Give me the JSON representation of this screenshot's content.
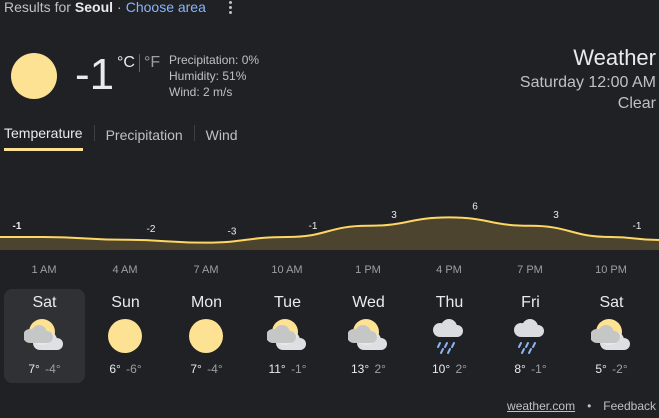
{
  "header": {
    "results_prefix": "Results for",
    "location": "Seoul",
    "separator": "·",
    "choose_area": "Choose area"
  },
  "current": {
    "temperature": "-1",
    "unit_c": "°C",
    "unit_f": "°F",
    "precipitation": "Precipitation: 0%",
    "humidity": "Humidity: 51%",
    "wind": "Wind: 2 m/s",
    "icon": "sun-icon"
  },
  "summary": {
    "title": "Weather",
    "time": "Saturday 12:00 AM",
    "condition": "Clear"
  },
  "tabs": [
    {
      "label": "Temperature",
      "active": true
    },
    {
      "label": "Precipitation",
      "active": false
    },
    {
      "label": "Wind",
      "active": false
    }
  ],
  "chart_data": {
    "type": "area",
    "x": [
      "1 AM",
      "4 AM",
      "7 AM",
      "10 AM",
      "1 PM",
      "4 PM",
      "7 PM",
      "10 PM"
    ],
    "values": [
      -1,
      -2,
      -3,
      -1,
      3,
      6,
      3,
      -1
    ],
    "labels": [
      "-1",
      "-2",
      "-3",
      "-1",
      "3",
      "6",
      "3",
      "-1"
    ],
    "line_color": "#fdd663",
    "fill_color": "#4d4430"
  },
  "days": [
    {
      "name": "Sat",
      "high": "7°",
      "low": "-4°",
      "icon": "partly-cloudy-icon",
      "selected": true
    },
    {
      "name": "Sun",
      "high": "6°",
      "low": "-6°",
      "icon": "sun-icon",
      "selected": false
    },
    {
      "name": "Mon",
      "high": "7°",
      "low": "-4°",
      "icon": "sun-icon",
      "selected": false
    },
    {
      "name": "Tue",
      "high": "11°",
      "low": "-1°",
      "icon": "partly-cloudy-icon",
      "selected": false
    },
    {
      "name": "Wed",
      "high": "13°",
      "low": "2°",
      "icon": "partly-cloudy-icon",
      "selected": false
    },
    {
      "name": "Thu",
      "high": "10°",
      "low": "2°",
      "icon": "rain-icon",
      "selected": false
    },
    {
      "name": "Fri",
      "high": "8°",
      "low": "-1°",
      "icon": "rain-icon",
      "selected": false
    },
    {
      "name": "Sat",
      "high": "5°",
      "low": "-2°",
      "icon": "partly-cloudy-icon",
      "selected": false
    }
  ],
  "footer": {
    "source": "weather.com",
    "separator": "•",
    "feedback": "Feedback"
  }
}
